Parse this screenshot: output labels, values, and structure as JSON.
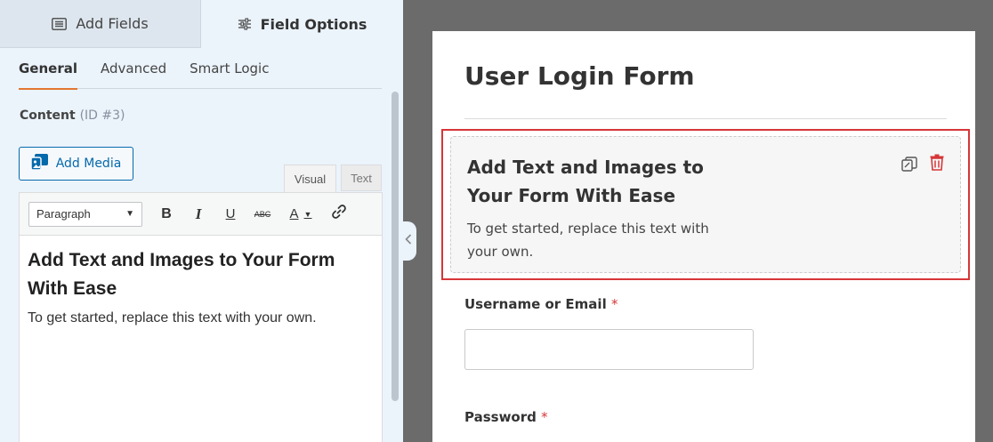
{
  "left_panel": {
    "top_tabs": [
      {
        "label": "Add Fields",
        "icon": "list-icon"
      },
      {
        "label": "Field Options",
        "icon": "sliders-icon"
      }
    ],
    "sub_tabs": [
      "General",
      "Advanced",
      "Smart Logic"
    ],
    "content_label": "Content",
    "content_id": "(ID #3)",
    "add_media_label": "Add Media",
    "editor_tabs": [
      "Visual",
      "Text"
    ],
    "toolbar": {
      "format_select": "Paragraph",
      "bold": "B",
      "italic": "I",
      "underline": "U",
      "strike": "ABC",
      "color": "A"
    },
    "editor_heading": "Add Text and Images to Your Form With Ease",
    "editor_para": "To get started, replace this text with your own."
  },
  "form": {
    "title": "User Login Form",
    "content_field": {
      "heading": "Add Text and Images to Your Form With Ease",
      "para": "To get started, replace this text with your own."
    },
    "fields": [
      {
        "label": "Username or Email",
        "required_mark": "*"
      },
      {
        "label": "Password",
        "required_mark": "*"
      }
    ]
  },
  "colors": {
    "accent_orange": "#e27730",
    "selection_red": "#d63638",
    "link_blue": "#056aab",
    "panel_bg": "#ebf3fb"
  }
}
